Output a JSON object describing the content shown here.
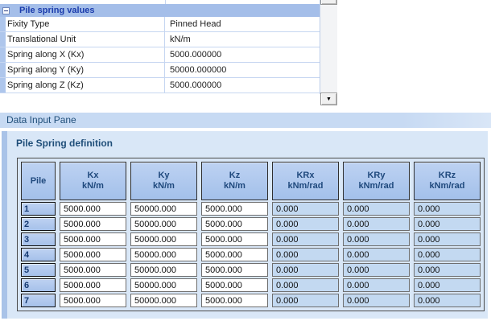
{
  "property_grid": {
    "category_label": "Pile spring values",
    "collapse_icon": "minus-box-icon",
    "rows": [
      {
        "name": "Fixity Type",
        "value": "Pinned Head"
      },
      {
        "name": "Translational Unit",
        "value": "kN/m"
      },
      {
        "name": "Spring along X (Kx)",
        "value": "5000.000000"
      },
      {
        "name": "Spring along Y (Ky)",
        "value": "50000.000000"
      },
      {
        "name": "Spring along Z (Kz)",
        "value": "5000.000000"
      }
    ],
    "scrollbar_down_glyph": "▼"
  },
  "data_input_pane": {
    "title": "Data Input Pane",
    "section_title": "Pile Spring definition",
    "table": {
      "columns": [
        {
          "label": "Pile",
          "unit": ""
        },
        {
          "label": "Kx",
          "unit": "kN/m"
        },
        {
          "label": "Ky",
          "unit": "kN/m"
        },
        {
          "label": "Kz",
          "unit": "kN/m"
        },
        {
          "label": "KRx",
          "unit": "kNm/rad"
        },
        {
          "label": "KRy",
          "unit": "kNm/rad"
        },
        {
          "label": "KRz",
          "unit": "kNm/rad"
        }
      ],
      "rows": [
        {
          "pile": "1",
          "kx": "5000.000",
          "ky": "50000.000",
          "kz": "5000.000",
          "krx": "0.000",
          "kry": "0.000",
          "krz": "0.000"
        },
        {
          "pile": "2",
          "kx": "5000.000",
          "ky": "50000.000",
          "kz": "5000.000",
          "krx": "0.000",
          "kry": "0.000",
          "krz": "0.000"
        },
        {
          "pile": "3",
          "kx": "5000.000",
          "ky": "50000.000",
          "kz": "5000.000",
          "krx": "0.000",
          "kry": "0.000",
          "krz": "0.000"
        },
        {
          "pile": "4",
          "kx": "5000.000",
          "ky": "50000.000",
          "kz": "5000.000",
          "krx": "0.000",
          "kry": "0.000",
          "krz": "0.000"
        },
        {
          "pile": "5",
          "kx": "5000.000",
          "ky": "50000.000",
          "kz": "5000.000",
          "krx": "0.000",
          "kry": "0.000",
          "krz": "0.000"
        },
        {
          "pile": "6",
          "kx": "5000.000",
          "ky": "50000.000",
          "kz": "5000.000",
          "krx": "0.000",
          "kry": "0.000",
          "krz": "0.000"
        },
        {
          "pile": "7",
          "kx": "5000.000",
          "ky": "50000.000",
          "kz": "5000.000",
          "krx": "0.000",
          "kry": "0.000",
          "krz": "0.000"
        }
      ]
    }
  },
  "colors": {
    "category_header_bg": "#a4bee9",
    "category_text": "#1b3cac",
    "pane_title_bg": "#c7daf3",
    "pane_title_text": "#1f4e79",
    "pane_bg": "#d9e7f7",
    "header_cell_bg": "#a5c0ea",
    "header_cell_text": "#1f497d",
    "blue_cell_bg": "#c3d9f1",
    "grid_line": "#c6d6f1"
  }
}
